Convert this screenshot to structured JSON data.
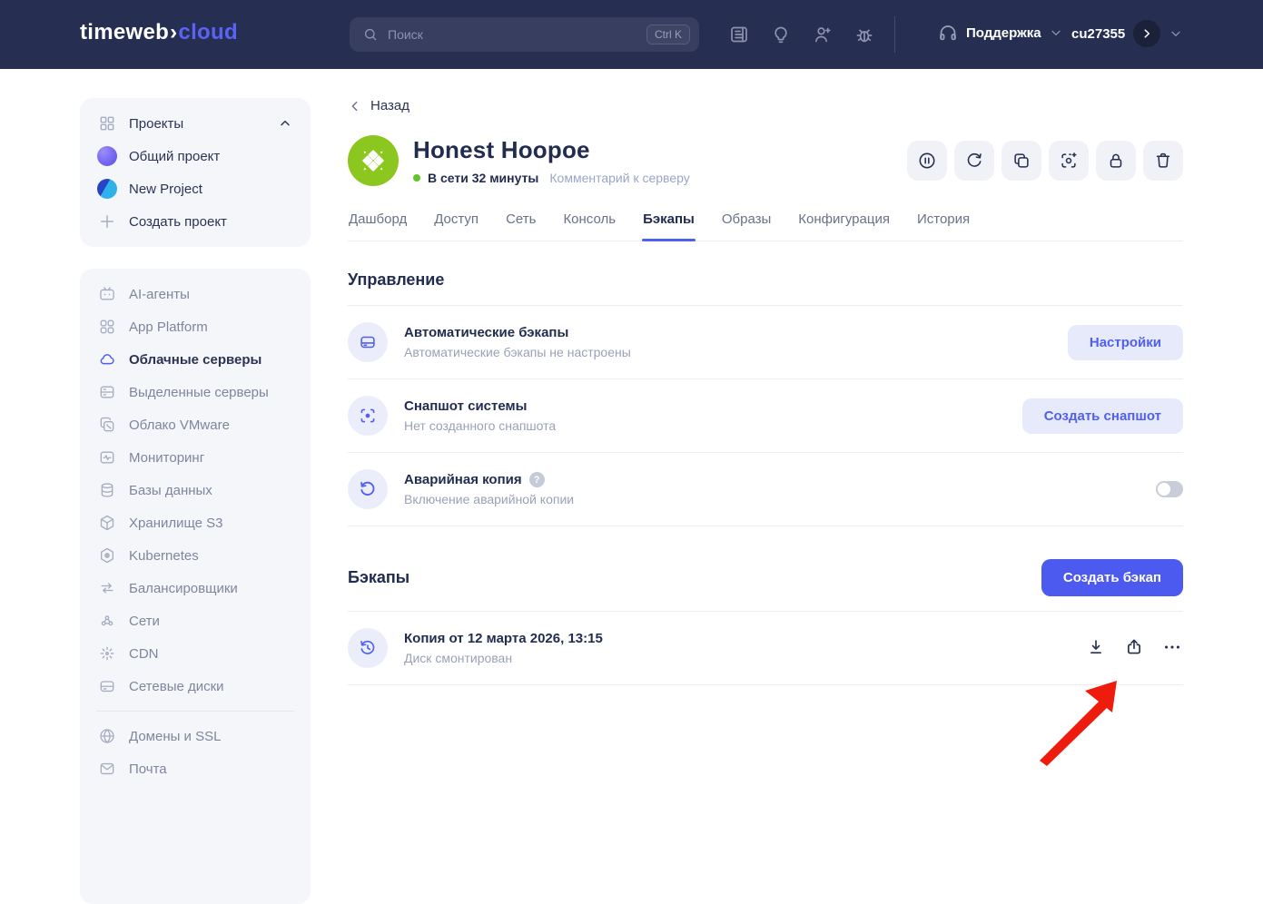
{
  "navbar": {
    "logo_primary": "timeweb",
    "logo_chevron": "›",
    "logo_secondary": "cloud",
    "search_placeholder": "Поиск",
    "search_shortcut": "Ctrl K",
    "support_label": "Поддержка",
    "account_id": "cu27355"
  },
  "sidebar": {
    "projects_header": "Проекты",
    "projects": [
      {
        "label": "Общий проект"
      },
      {
        "label": "New Project"
      }
    ],
    "create_project_label": "Создать проект",
    "services": [
      {
        "label": "AI-агенты"
      },
      {
        "label": "App Platform"
      },
      {
        "label": "Облачные серверы"
      },
      {
        "label": "Выделенные серверы"
      },
      {
        "label": "Облако VMware"
      },
      {
        "label": "Мониторинг"
      },
      {
        "label": "Базы данных"
      },
      {
        "label": "Хранилище S3"
      },
      {
        "label": "Kubernetes"
      },
      {
        "label": "Балансировщики"
      },
      {
        "label": "Сети"
      },
      {
        "label": "CDN"
      },
      {
        "label": "Сетевые диски"
      }
    ],
    "services_secondary": [
      {
        "label": "Домены и SSL"
      },
      {
        "label": "Почта"
      }
    ],
    "active_service": "Облачные серверы"
  },
  "main": {
    "back_label": "Назад",
    "server_name": "Honest Hoopoe",
    "server_status": "В сети 32 минуты",
    "comment_link": "Комментарий к серверу",
    "tabs": [
      {
        "label": "Дашборд"
      },
      {
        "label": "Доступ"
      },
      {
        "label": "Сеть"
      },
      {
        "label": "Консоль"
      },
      {
        "label": "Бэкапы"
      },
      {
        "label": "Образы"
      },
      {
        "label": "Конфигурация"
      },
      {
        "label": "История"
      }
    ],
    "active_tab": "Бэкапы",
    "management": {
      "title": "Управление",
      "rows": [
        {
          "title": "Автоматические бэкапы",
          "subtitle": "Автоматические бэкапы не настроены",
          "action_label": "Настройки"
        },
        {
          "title": "Снапшот системы",
          "subtitle": "Нет созданного снапшота",
          "action_label": "Создать снапшот"
        },
        {
          "title": "Аварийная копия",
          "subtitle": "Включение аварийной копии",
          "toggle_state": "off"
        }
      ]
    },
    "backups": {
      "title": "Бэкапы",
      "create_label": "Создать бэкап",
      "rows": [
        {
          "title": "Копия от 12 марта 2026, 13:15",
          "subtitle": "Диск смонтирован"
        }
      ]
    }
  },
  "colors": {
    "navbar_bg": "#262e52",
    "accent": "#4f5ff0",
    "accent_soft_bg": "#e7eafb",
    "server_avatar_green": "#8bc71e",
    "online_dot": "#61c424",
    "annotation_arrow": "#ee1c0c"
  }
}
